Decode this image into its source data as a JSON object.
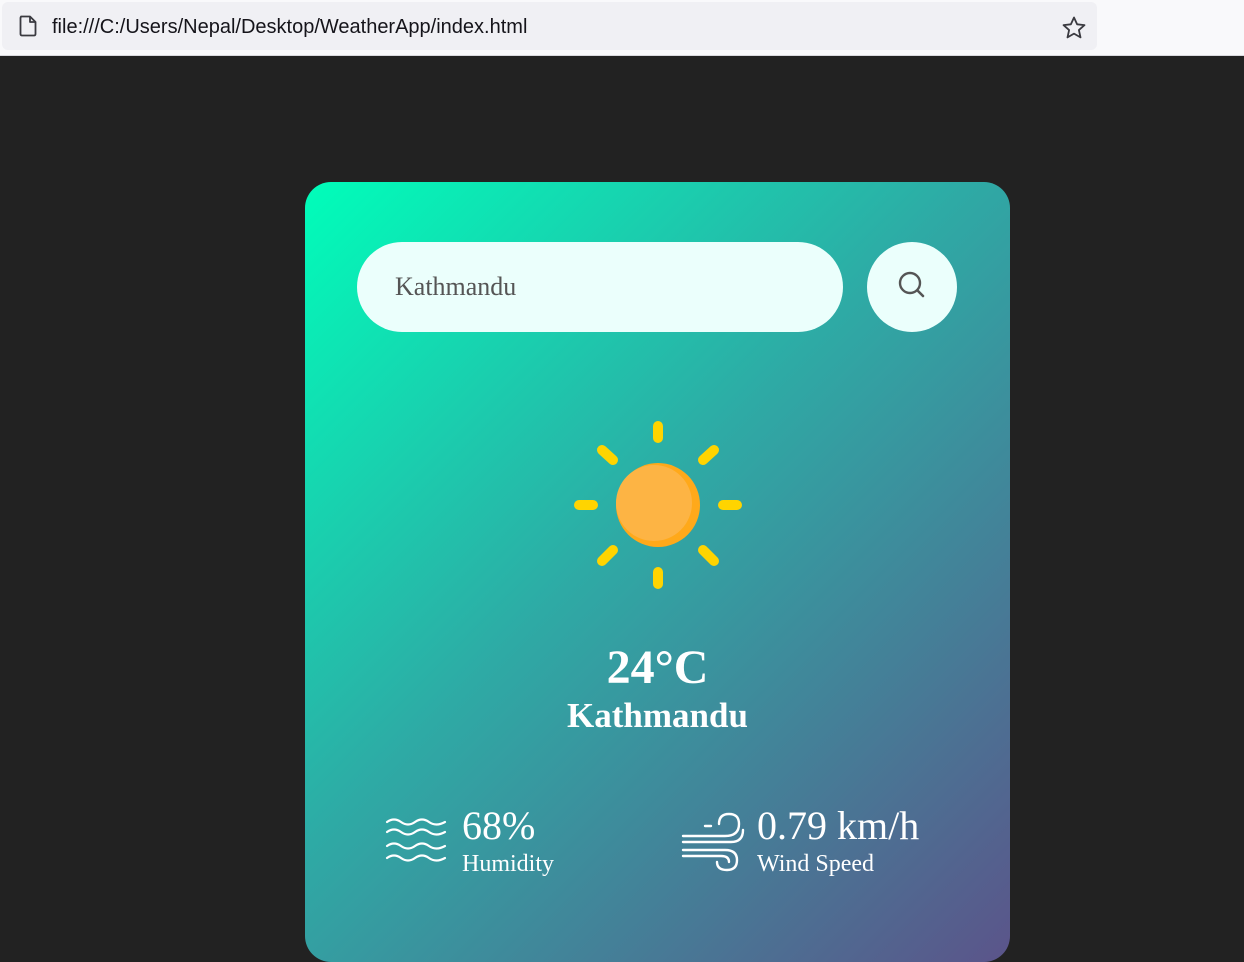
{
  "browser": {
    "url": "file:///C:/Users/Nepal/Desktop/WeatherApp/index.html",
    "page_icon": "document-icon",
    "bookmark_icon": "star-icon"
  },
  "search": {
    "value": "Kathmandu",
    "button_icon": "search-icon"
  },
  "weather": {
    "icon": "sun-icon",
    "temperature": "24°C",
    "city": "Kathmandu"
  },
  "details": {
    "humidity": {
      "icon": "humidity-waves-icon",
      "value": "68%",
      "label": "Humidity"
    },
    "wind": {
      "icon": "wind-icon",
      "value": "0.79 km/h",
      "label": "Wind Speed"
    }
  },
  "colors": {
    "page_background": "#222222",
    "card_gradient_start": "#00feba",
    "card_gradient_end": "#5b548a",
    "input_background": "#ebfffc",
    "sun_rays": "#ffd400",
    "sun_body": "#fdb444"
  }
}
